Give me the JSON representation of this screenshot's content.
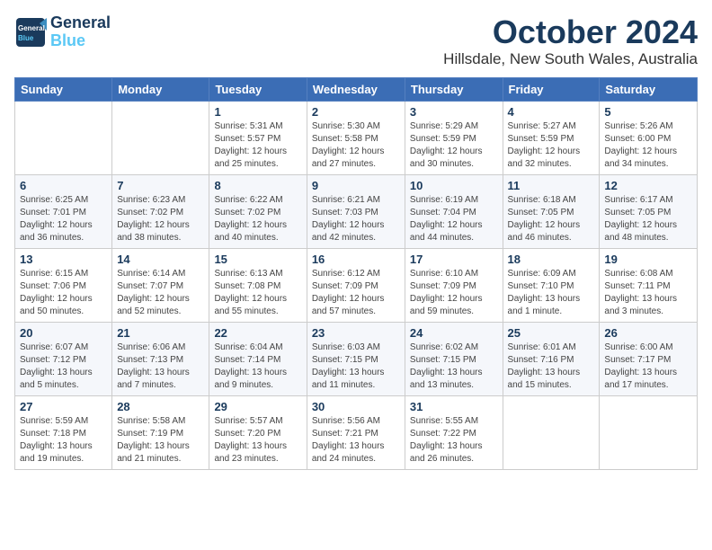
{
  "header": {
    "logo_line1": "General",
    "logo_line2": "Blue",
    "title": "October 2024",
    "subtitle": "Hillsdale, New South Wales, Australia"
  },
  "days_of_week": [
    "Sunday",
    "Monday",
    "Tuesday",
    "Wednesday",
    "Thursday",
    "Friday",
    "Saturday"
  ],
  "weeks": [
    [
      {
        "day": "",
        "detail": ""
      },
      {
        "day": "",
        "detail": ""
      },
      {
        "day": "1",
        "detail": "Sunrise: 5:31 AM\nSunset: 5:57 PM\nDaylight: 12 hours\nand 25 minutes."
      },
      {
        "day": "2",
        "detail": "Sunrise: 5:30 AM\nSunset: 5:58 PM\nDaylight: 12 hours\nand 27 minutes."
      },
      {
        "day": "3",
        "detail": "Sunrise: 5:29 AM\nSunset: 5:59 PM\nDaylight: 12 hours\nand 30 minutes."
      },
      {
        "day": "4",
        "detail": "Sunrise: 5:27 AM\nSunset: 5:59 PM\nDaylight: 12 hours\nand 32 minutes."
      },
      {
        "day": "5",
        "detail": "Sunrise: 5:26 AM\nSunset: 6:00 PM\nDaylight: 12 hours\nand 34 minutes."
      }
    ],
    [
      {
        "day": "6",
        "detail": "Sunrise: 6:25 AM\nSunset: 7:01 PM\nDaylight: 12 hours\nand 36 minutes."
      },
      {
        "day": "7",
        "detail": "Sunrise: 6:23 AM\nSunset: 7:02 PM\nDaylight: 12 hours\nand 38 minutes."
      },
      {
        "day": "8",
        "detail": "Sunrise: 6:22 AM\nSunset: 7:02 PM\nDaylight: 12 hours\nand 40 minutes."
      },
      {
        "day": "9",
        "detail": "Sunrise: 6:21 AM\nSunset: 7:03 PM\nDaylight: 12 hours\nand 42 minutes."
      },
      {
        "day": "10",
        "detail": "Sunrise: 6:19 AM\nSunset: 7:04 PM\nDaylight: 12 hours\nand 44 minutes."
      },
      {
        "day": "11",
        "detail": "Sunrise: 6:18 AM\nSunset: 7:05 PM\nDaylight: 12 hours\nand 46 minutes."
      },
      {
        "day": "12",
        "detail": "Sunrise: 6:17 AM\nSunset: 7:05 PM\nDaylight: 12 hours\nand 48 minutes."
      }
    ],
    [
      {
        "day": "13",
        "detail": "Sunrise: 6:15 AM\nSunset: 7:06 PM\nDaylight: 12 hours\nand 50 minutes."
      },
      {
        "day": "14",
        "detail": "Sunrise: 6:14 AM\nSunset: 7:07 PM\nDaylight: 12 hours\nand 52 minutes."
      },
      {
        "day": "15",
        "detail": "Sunrise: 6:13 AM\nSunset: 7:08 PM\nDaylight: 12 hours\nand 55 minutes."
      },
      {
        "day": "16",
        "detail": "Sunrise: 6:12 AM\nSunset: 7:09 PM\nDaylight: 12 hours\nand 57 minutes."
      },
      {
        "day": "17",
        "detail": "Sunrise: 6:10 AM\nSunset: 7:09 PM\nDaylight: 12 hours\nand 59 minutes."
      },
      {
        "day": "18",
        "detail": "Sunrise: 6:09 AM\nSunset: 7:10 PM\nDaylight: 13 hours\nand 1 minute."
      },
      {
        "day": "19",
        "detail": "Sunrise: 6:08 AM\nSunset: 7:11 PM\nDaylight: 13 hours\nand 3 minutes."
      }
    ],
    [
      {
        "day": "20",
        "detail": "Sunrise: 6:07 AM\nSunset: 7:12 PM\nDaylight: 13 hours\nand 5 minutes."
      },
      {
        "day": "21",
        "detail": "Sunrise: 6:06 AM\nSunset: 7:13 PM\nDaylight: 13 hours\nand 7 minutes."
      },
      {
        "day": "22",
        "detail": "Sunrise: 6:04 AM\nSunset: 7:14 PM\nDaylight: 13 hours\nand 9 minutes."
      },
      {
        "day": "23",
        "detail": "Sunrise: 6:03 AM\nSunset: 7:15 PM\nDaylight: 13 hours\nand 11 minutes."
      },
      {
        "day": "24",
        "detail": "Sunrise: 6:02 AM\nSunset: 7:15 PM\nDaylight: 13 hours\nand 13 minutes."
      },
      {
        "day": "25",
        "detail": "Sunrise: 6:01 AM\nSunset: 7:16 PM\nDaylight: 13 hours\nand 15 minutes."
      },
      {
        "day": "26",
        "detail": "Sunrise: 6:00 AM\nSunset: 7:17 PM\nDaylight: 13 hours\nand 17 minutes."
      }
    ],
    [
      {
        "day": "27",
        "detail": "Sunrise: 5:59 AM\nSunset: 7:18 PM\nDaylight: 13 hours\nand 19 minutes."
      },
      {
        "day": "28",
        "detail": "Sunrise: 5:58 AM\nSunset: 7:19 PM\nDaylight: 13 hours\nand 21 minutes."
      },
      {
        "day": "29",
        "detail": "Sunrise: 5:57 AM\nSunset: 7:20 PM\nDaylight: 13 hours\nand 23 minutes."
      },
      {
        "day": "30",
        "detail": "Sunrise: 5:56 AM\nSunset: 7:21 PM\nDaylight: 13 hours\nand 24 minutes."
      },
      {
        "day": "31",
        "detail": "Sunrise: 5:55 AM\nSunset: 7:22 PM\nDaylight: 13 hours\nand 26 minutes."
      },
      {
        "day": "",
        "detail": ""
      },
      {
        "day": "",
        "detail": ""
      }
    ]
  ]
}
